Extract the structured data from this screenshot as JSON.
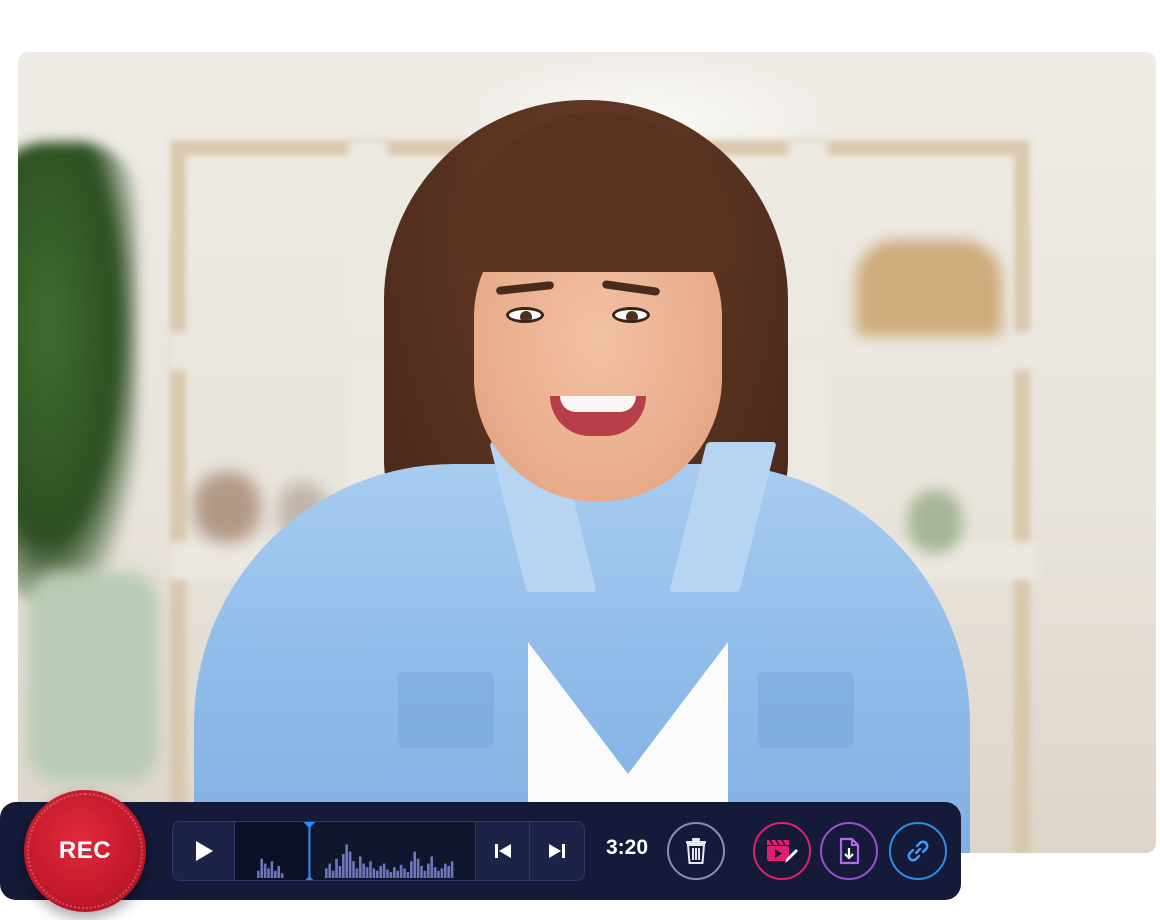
{
  "recorder": {
    "rec_label": "REC",
    "time_display": "3:20",
    "playhead_fraction": 0.31
  },
  "player": {
    "buttons": [
      "play-icon",
      "skip-back-icon",
      "skip-forward-icon"
    ]
  },
  "actions": [
    {
      "icon": "trash-icon",
      "color": "#8b91b3"
    },
    {
      "icon": "video-edit-icon",
      "color": "#e21f6f"
    },
    {
      "icon": "download-file-icon",
      "color": "#9c4ed6"
    },
    {
      "icon": "link-icon",
      "color": "#2a8ef0"
    }
  ],
  "colors": {
    "bar_bg": "#141a38",
    "rec_red": "#d21f31",
    "accent_blue": "#2a8ef0"
  }
}
